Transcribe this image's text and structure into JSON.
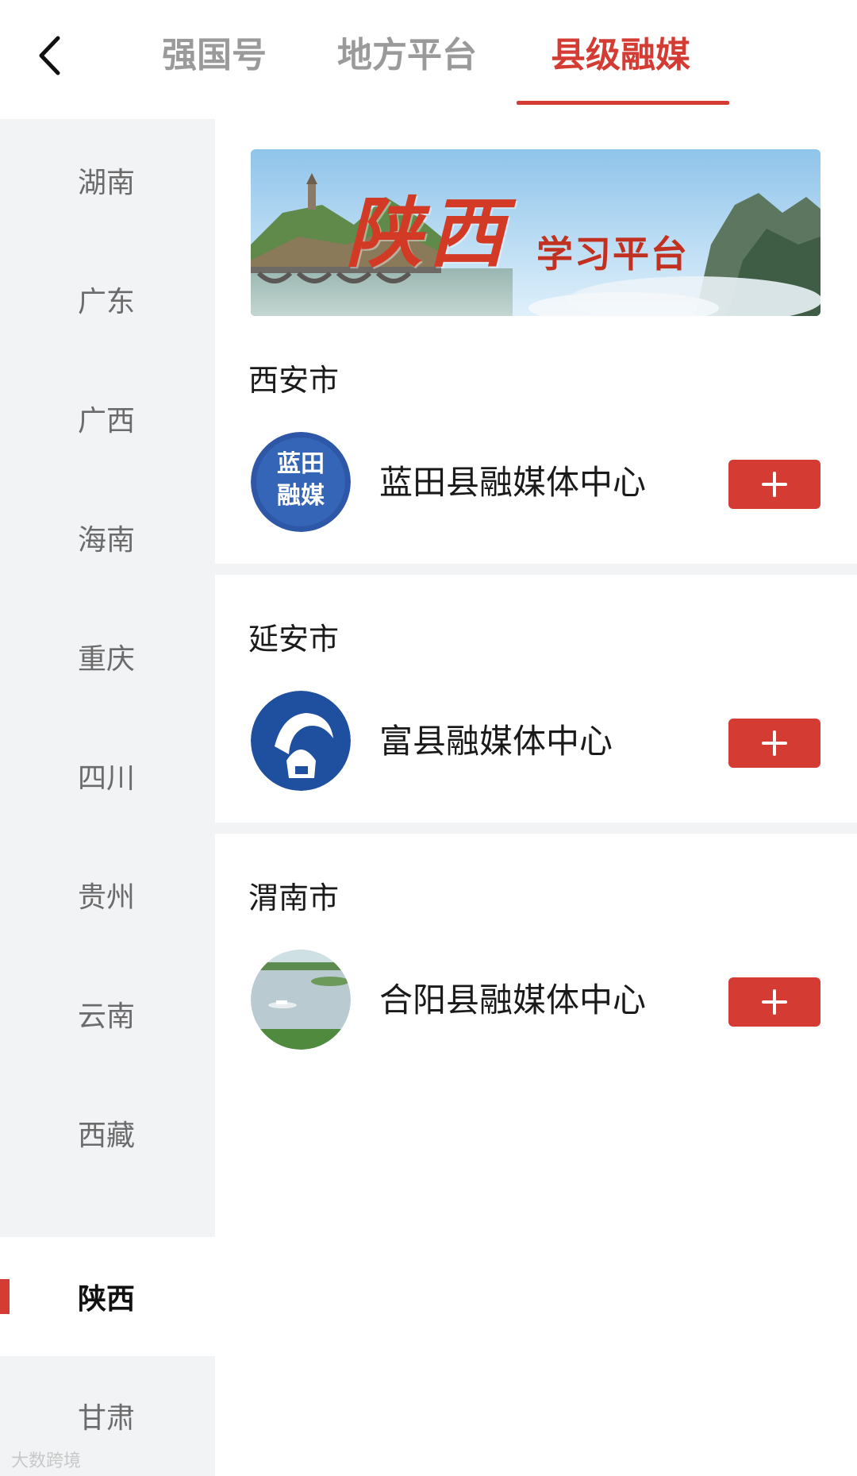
{
  "header": {
    "tabs": [
      {
        "label": "强国号",
        "active": false
      },
      {
        "label": "地方平台",
        "active": false
      },
      {
        "label": "县级融媒",
        "active": true
      }
    ],
    "accent_color": "#d43c33"
  },
  "sidebar": {
    "items": [
      {
        "label": "湖南"
      },
      {
        "label": "广东"
      },
      {
        "label": "广西"
      },
      {
        "label": "海南"
      },
      {
        "label": "重庆"
      },
      {
        "label": "四川"
      },
      {
        "label": "贵州"
      },
      {
        "label": "云南"
      },
      {
        "label": "西藏"
      },
      {
        "label": "陕西",
        "active": true
      },
      {
        "label": "甘肃"
      }
    ]
  },
  "banner": {
    "title": "陕西",
    "subtitle": "学习平台"
  },
  "sections": [
    {
      "city": "西安市",
      "org": {
        "name": "蓝田县融媒体中心",
        "logo_text_top": "蓝田",
        "logo_text_bottom": "融媒"
      }
    },
    {
      "city": "延安市",
      "org": {
        "name": "富县融媒体中心"
      }
    },
    {
      "city": "渭南市",
      "org": {
        "name": "合阳县融媒体中心"
      }
    }
  ],
  "watermark": "大数跨境"
}
